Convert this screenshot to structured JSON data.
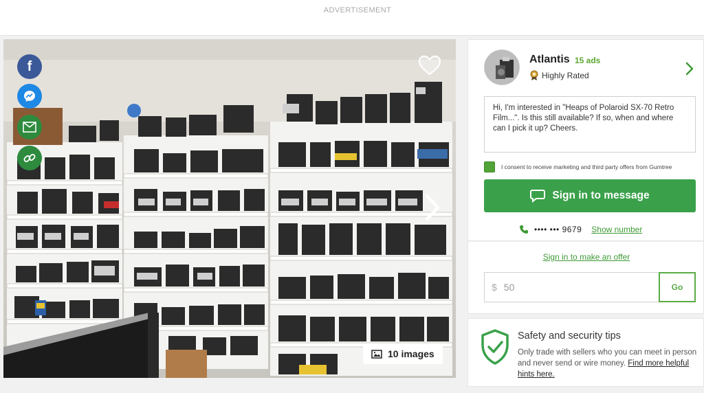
{
  "ad_banner": {
    "label": "ADVERTISEMENT"
  },
  "gallery": {
    "image_count_label": "10 images",
    "share_buttons": [
      "facebook-icon",
      "messenger-icon",
      "email-icon",
      "link-icon"
    ]
  },
  "seller": {
    "name": "Atlantis",
    "ads_count": "15 ads",
    "badge": "Highly Rated"
  },
  "message": {
    "text": "Hi, I'm interested in \"Heaps of Polaroid SX-70 Retro Film...\". Is this still available? If so, when and where can I pick it up? Cheers.",
    "consent_label": "I consent to receive marketing and third party offers from Gumtree",
    "consent_checked": true,
    "cta_label": "Sign in to message"
  },
  "phone": {
    "masked": "•••• ••• 9679",
    "show_label": "Show number"
  },
  "offer": {
    "link_label": "Sign in to make an offer",
    "currency": "$",
    "placeholder": "50",
    "go_label": "Go"
  },
  "safety": {
    "title": "Safety and security tips",
    "text": "Only trade with sellers who you can meet in person and never send or wire money.",
    "link_label": "Find more helpful hints here."
  },
  "colors": {
    "accent_green": "#3aa14a",
    "link_green": "#3f9a35",
    "facebook_blue": "#3b5998",
    "messenger_blue": "#1e88e5",
    "share_green": "#2e8b3e"
  }
}
